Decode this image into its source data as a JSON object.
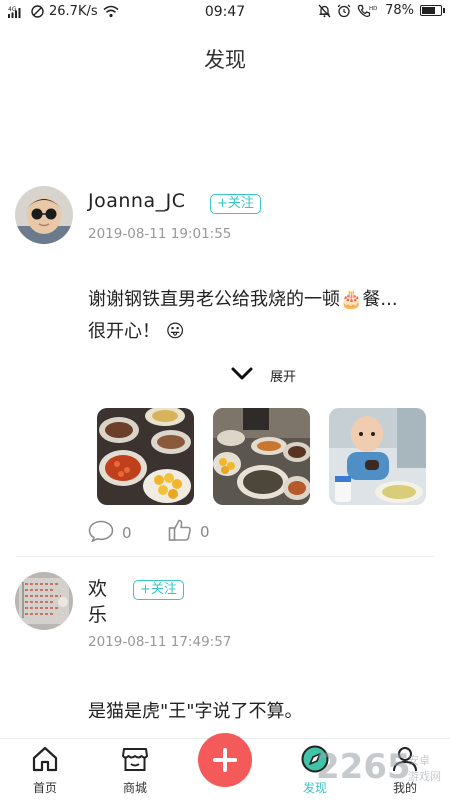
{
  "status_bar": {
    "network_type": "4G",
    "speed": "26.7K/s",
    "time": "09:47",
    "battery": "78%",
    "battery_level": 0.78
  },
  "header": {
    "title": "发现"
  },
  "posts": [
    {
      "username": "Joanna_JC",
      "follow_label": "+关注",
      "timestamp": "2019-08-11 19:01:55",
      "text_line1": "谢谢钢铁直男老公给我烧的一顿🎂餐...",
      "text_line2": "很开心！ 😛",
      "expand_label": "展开",
      "comments": "0",
      "likes": "0"
    },
    {
      "username_line1": "欢",
      "username_line2": "乐",
      "follow_label": "+关注",
      "timestamp": "2019-08-11 17:49:57",
      "text": "是猫是虎\"王\"字说了不算。"
    }
  ],
  "bottom_nav": {
    "items": [
      {
        "label": "首页"
      },
      {
        "label": "商城"
      },
      {
        "label": "发现"
      },
      {
        "label": "我的"
      }
    ],
    "active_color": "#3bc4c8",
    "fab_color": "#f45a5a"
  },
  "watermark": {
    "text": "2265",
    "subtext": "安卓游戏网"
  }
}
